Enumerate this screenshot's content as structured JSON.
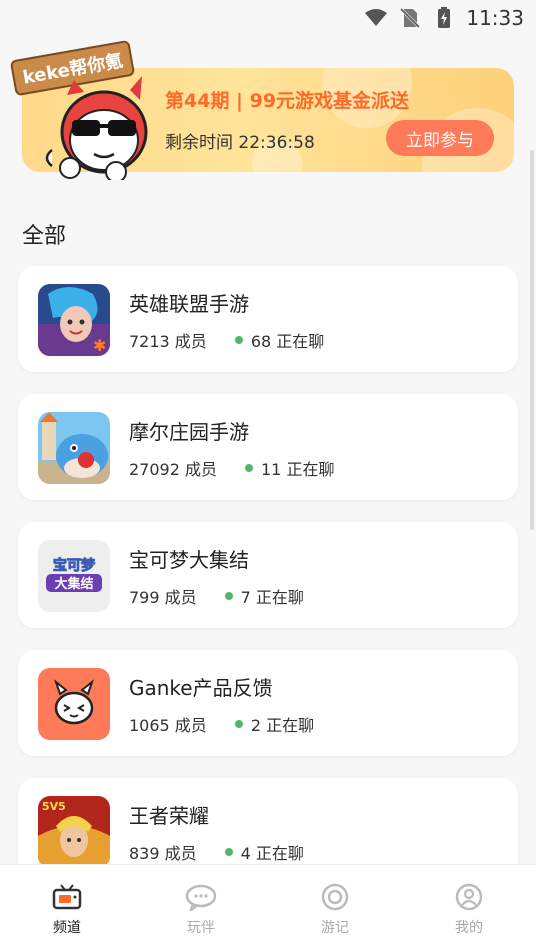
{
  "status_bar": {
    "time": "11:33",
    "icons": [
      "wifi-icon",
      "no-sim-icon",
      "battery-charging-icon"
    ]
  },
  "banner": {
    "mascot_sign": "keke帮你氪",
    "title": "第44期 | 99元游戏基金派送",
    "countdown": "剩余时间 22:36:58",
    "cta": "立即参与",
    "colors": {
      "accent": "#ff6a2b",
      "button": "#ff7a58",
      "background": "#ffd98a"
    }
  },
  "section": {
    "title": "全部"
  },
  "channels": [
    {
      "name": "英雄联盟手游",
      "members": "7213 成员",
      "online": "68 正在聊",
      "icon": "lol-game-icon"
    },
    {
      "name": "摩尔庄园手游",
      "members": "27092 成员",
      "online": "11 正在聊",
      "icon": "mole-manor-game-icon"
    },
    {
      "name": "宝可梦大集结",
      "members": "799 成员",
      "online": "7 正在聊",
      "icon": "pokemon-unite-game-icon",
      "icon_text_top": "宝可梦",
      "icon_text_bottom": "大集结"
    },
    {
      "name": "Ganke产品反馈",
      "members": "1065 成员",
      "online": "2 正在聊",
      "icon": "ganke-mascot-icon"
    },
    {
      "name": "王者荣耀",
      "members": "839 成员",
      "online": "4 正在聊",
      "icon": "honor-of-kings-game-icon",
      "icon_badge": "5V5"
    }
  ],
  "tabbar": {
    "items": [
      {
        "label": "频道",
        "icon": "tv-icon",
        "active": true
      },
      {
        "label": "玩伴",
        "icon": "chat-bubble-icon",
        "active": false
      },
      {
        "label": "游记",
        "icon": "circle-target-icon",
        "active": false
      },
      {
        "label": "我的",
        "icon": "user-icon",
        "active": false
      }
    ]
  },
  "online_dot_color": "#4cb86b"
}
